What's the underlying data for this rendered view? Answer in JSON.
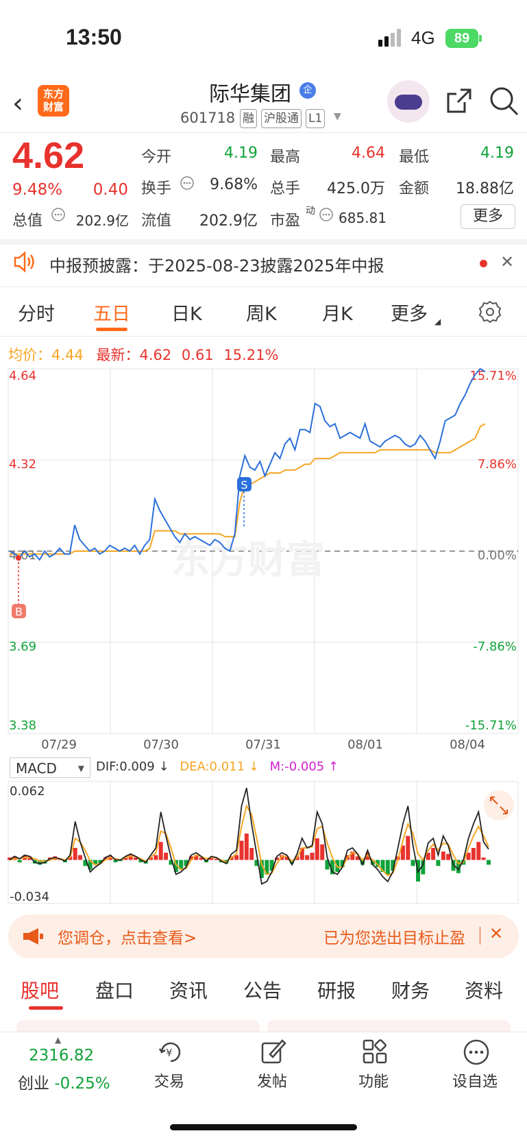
{
  "status": {
    "time": "13:50",
    "network": "4G",
    "battery": "89"
  },
  "header": {
    "logo": [
      "东方",
      "财富"
    ],
    "name": "际华集团",
    "badge": "企",
    "code": "601718",
    "tags": [
      "融",
      "沪股通",
      "L1"
    ]
  },
  "quote": {
    "price": "4.62",
    "change_pct": "9.48%",
    "change": "0.40",
    "open_label": "今开",
    "open": "4.19",
    "high_label": "最高",
    "high": "4.64",
    "low_label": "最低",
    "low": "4.19",
    "turnover_label": "换手",
    "turnover": "9.68%",
    "volume_label": "总手",
    "volume": "425.0万",
    "amount_label": "金额",
    "amount": "18.88亿",
    "mcap_label": "总值",
    "mcap": "202.9亿",
    "float_label": "流值",
    "float": "202.9亿",
    "pe_label": "市盈",
    "pe_sup": "动",
    "pe": "685.81",
    "more": "更多"
  },
  "notice": {
    "text": "中报预披露：于2025-08-23披露2025年中报"
  },
  "ktabs": {
    "t1": "分时",
    "t2": "五日",
    "t3": "日K",
    "t4": "周K",
    "t5": "月K",
    "t6": "更多"
  },
  "legend": {
    "avg_label": "均价：",
    "avg": "4.44",
    "latest_label": "最新：",
    "latest": "4.62",
    "chg": "0.61",
    "pct": "15.21%"
  },
  "chart_data": [
    {
      "type": "line",
      "x_labels": [
        "07/29",
        "07/30",
        "07/31",
        "08/01",
        "08/04"
      ],
      "y_left": [
        "4.64",
        "4.32",
        "4.01",
        "3.69",
        "3.38"
      ],
      "y_right": [
        "15.71%",
        "7.86%",
        "0.00%",
        "-7.86%",
        "-15.71%"
      ],
      "ylim": [
        3.38,
        4.64
      ],
      "series": [
        {
          "color": "#2a6fdb",
          "values": [
            4.01,
            4.0,
            3.99,
            4.01,
            3.99,
            4.0,
            3.98,
            4.01,
            3.99,
            4.0,
            4.02,
            4.0,
            4.0,
            4.1,
            4.05,
            4.03,
            4.01,
            4.02,
            4.0,
            4.01,
            4.03,
            4.02,
            4.01,
            4.02,
            4.01,
            4.03,
            4.0,
            4.03,
            4.05,
            4.19,
            4.15,
            4.12,
            4.09,
            4.06,
            4.04,
            4.07,
            4.05,
            4.06,
            4.05,
            4.04,
            4.03,
            4.05,
            4.04,
            4.02,
            4.01,
            4.07,
            4.27,
            4.34,
            4.3,
            4.29,
            4.32,
            4.27,
            4.31,
            4.35,
            4.33,
            4.38,
            4.4,
            4.36,
            4.43,
            4.43,
            4.42,
            4.52,
            4.51,
            4.46,
            4.44,
            4.45,
            4.4,
            4.41,
            4.42,
            4.41,
            4.4,
            4.45,
            4.39,
            4.38,
            4.37,
            4.39,
            4.4,
            4.41,
            4.4,
            4.38,
            4.37,
            4.38,
            4.41,
            4.39,
            4.36,
            4.33,
            4.39,
            4.46,
            4.47,
            4.48,
            4.52,
            4.55,
            4.59,
            4.62,
            4.64,
            4.63
          ]
        },
        {
          "color": "#f5a623",
          "values": [
            4.0,
            4.0,
            4.0,
            4.0,
            4.0,
            4.0,
            4.0,
            4.0,
            4.0,
            4.0,
            4.0,
            4.0,
            4.0,
            4.01,
            4.01,
            4.01,
            4.01,
            4.01,
            4.01,
            4.01,
            4.01,
            4.01,
            4.01,
            4.01,
            4.01,
            4.01,
            4.01,
            4.01,
            4.02,
            4.08,
            4.08,
            4.08,
            4.08,
            4.08,
            4.07,
            4.07,
            4.07,
            4.07,
            4.07,
            4.07,
            4.07,
            4.07,
            4.07,
            4.06,
            4.06,
            4.06,
            4.18,
            4.24,
            4.24,
            4.25,
            4.26,
            4.27,
            4.28,
            4.28,
            4.28,
            4.29,
            4.29,
            4.29,
            4.3,
            4.31,
            4.31,
            4.33,
            4.33,
            4.33,
            4.33,
            4.34,
            4.35,
            4.35,
            4.35,
            4.35,
            4.35,
            4.35,
            4.35,
            4.35,
            4.36,
            4.36,
            4.36,
            4.36,
            4.36,
            4.36,
            4.36,
            4.36,
            4.36,
            4.36,
            4.36,
            4.35,
            4.35,
            4.35,
            4.35,
            4.36,
            4.37,
            4.38,
            4.39,
            4.4,
            4.44,
            4.45
          ]
        }
      ],
      "markers": {
        "buy": "B",
        "sell": "S"
      }
    },
    {
      "type": "bar",
      "title": "MACD",
      "dif_label": "DIF:0.009 ↓",
      "dea_label": "DEA:0.011 ↓",
      "m_label": "M:-0.005 ↑",
      "y_labels": [
        "0.062",
        "-0.034"
      ],
      "ylim": [
        -0.034,
        0.062
      ],
      "hist": [
        0.002,
        0.003,
        -0.002,
        0.004,
        0.003,
        -0.003,
        -0.004,
        -0.003,
        0.002,
        0.003,
        0.001,
        -0.002,
        0.003,
        0.01,
        0.004,
        -0.005,
        -0.008,
        -0.004,
        -0.003,
        0.002,
        0.003,
        -0.002,
        -0.001,
        0.002,
        0.004,
        0.002,
        -0.002,
        -0.003,
        0.002,
        0.004,
        0.015,
        0.006,
        -0.004,
        -0.01,
        -0.008,
        -0.005,
        0.003,
        0.004,
        0.002,
        -0.002,
        0.002,
        0.001,
        -0.002,
        -0.003,
        0.003,
        0.004,
        0.016,
        0.022,
        0.01,
        -0.005,
        -0.015,
        -0.012,
        -0.009,
        0.002,
        0.004,
        0.003,
        -0.003,
        0.003,
        0.01,
        0.004,
        0.006,
        0.018,
        0.013,
        -0.008,
        -0.012,
        -0.01,
        -0.006,
        0.004,
        0.007,
        0.003,
        -0.004,
        0.006,
        -0.004,
        -0.006,
        -0.01,
        -0.012,
        -0.009,
        0.003,
        0.012,
        0.02,
        -0.005,
        -0.018,
        -0.012,
        0.006,
        0.01,
        -0.005,
        0.007,
        0.005,
        -0.009,
        -0.011,
        -0.004,
        0.006,
        0.01,
        0.015,
        0.002,
        -0.004
      ],
      "dif": [
        0.0,
        0.003,
        0.001,
        0.004,
        0.003,
        -0.002,
        -0.003,
        -0.002,
        0.001,
        0.002,
        0.001,
        -0.001,
        0.004,
        0.032,
        0.015,
        0.002,
        -0.01,
        -0.006,
        -0.003,
        0.002,
        0.004,
        0.0,
        0.0,
        0.003,
        0.005,
        0.003,
        0.0,
        -0.002,
        0.004,
        0.01,
        0.04,
        0.02,
        0.002,
        -0.012,
        -0.01,
        -0.006,
        0.004,
        0.006,
        0.003,
        -0.001,
        0.003,
        0.002,
        -0.001,
        -0.003,
        0.005,
        0.008,
        0.045,
        0.06,
        0.03,
        0.005,
        -0.02,
        -0.018,
        -0.01,
        0.003,
        0.006,
        0.004,
        -0.004,
        0.005,
        0.018,
        0.01,
        0.012,
        0.04,
        0.03,
        0.002,
        -0.01,
        -0.012,
        -0.006,
        0.008,
        0.01,
        0.005,
        -0.004,
        0.008,
        -0.004,
        -0.008,
        -0.014,
        -0.018,
        -0.01,
        0.01,
        0.03,
        0.045,
        0.012,
        -0.01,
        -0.004,
        0.014,
        0.018,
        0.004,
        0.02,
        0.012,
        -0.004,
        -0.008,
        0.0,
        0.018,
        0.03,
        0.04,
        0.015,
        0.009
      ],
      "dea": [
        0.0,
        0.001,
        0.001,
        0.002,
        0.002,
        0.001,
        -0.001,
        -0.001,
        0.0,
        0.001,
        0.001,
        0.0,
        0.002,
        0.018,
        0.015,
        0.008,
        -0.001,
        -0.004,
        -0.003,
        0.0,
        0.002,
        0.001,
        0.0,
        0.002,
        0.003,
        0.003,
        0.001,
        -0.001,
        0.002,
        0.006,
        0.024,
        0.022,
        0.01,
        -0.004,
        -0.008,
        -0.007,
        0.0,
        0.004,
        0.003,
        0.001,
        0.002,
        0.002,
        0.0,
        -0.002,
        0.002,
        0.005,
        0.028,
        0.045,
        0.038,
        0.018,
        -0.004,
        -0.012,
        -0.011,
        -0.003,
        0.003,
        0.003,
        -0.001,
        0.002,
        0.01,
        0.01,
        0.011,
        0.026,
        0.028,
        0.014,
        0.002,
        -0.006,
        -0.006,
        0.002,
        0.006,
        0.005,
        0.0,
        0.004,
        0.0,
        -0.004,
        -0.009,
        -0.013,
        -0.011,
        0.0,
        0.016,
        0.03,
        0.022,
        0.005,
        0.0,
        0.008,
        0.013,
        0.008,
        0.014,
        0.013,
        0.004,
        -0.003,
        -0.002,
        0.01,
        0.02,
        0.028,
        0.02,
        0.011
      ]
    }
  ],
  "promo": {
    "left": "您调仓，点击查看>",
    "right": "已为您选出目标止盈"
  },
  "btabs": {
    "t1": "股吧",
    "t2": "盘口",
    "t3": "资讯",
    "t4": "公告",
    "t5": "研报",
    "t6": "财务",
    "t7": "资料"
  },
  "toolbar": {
    "index_value": "2316.82",
    "index_name": "创业",
    "index_pct": "-0.25%",
    "trade": "交易",
    "post": "发帖",
    "func": "功能",
    "watch": "设自选"
  }
}
